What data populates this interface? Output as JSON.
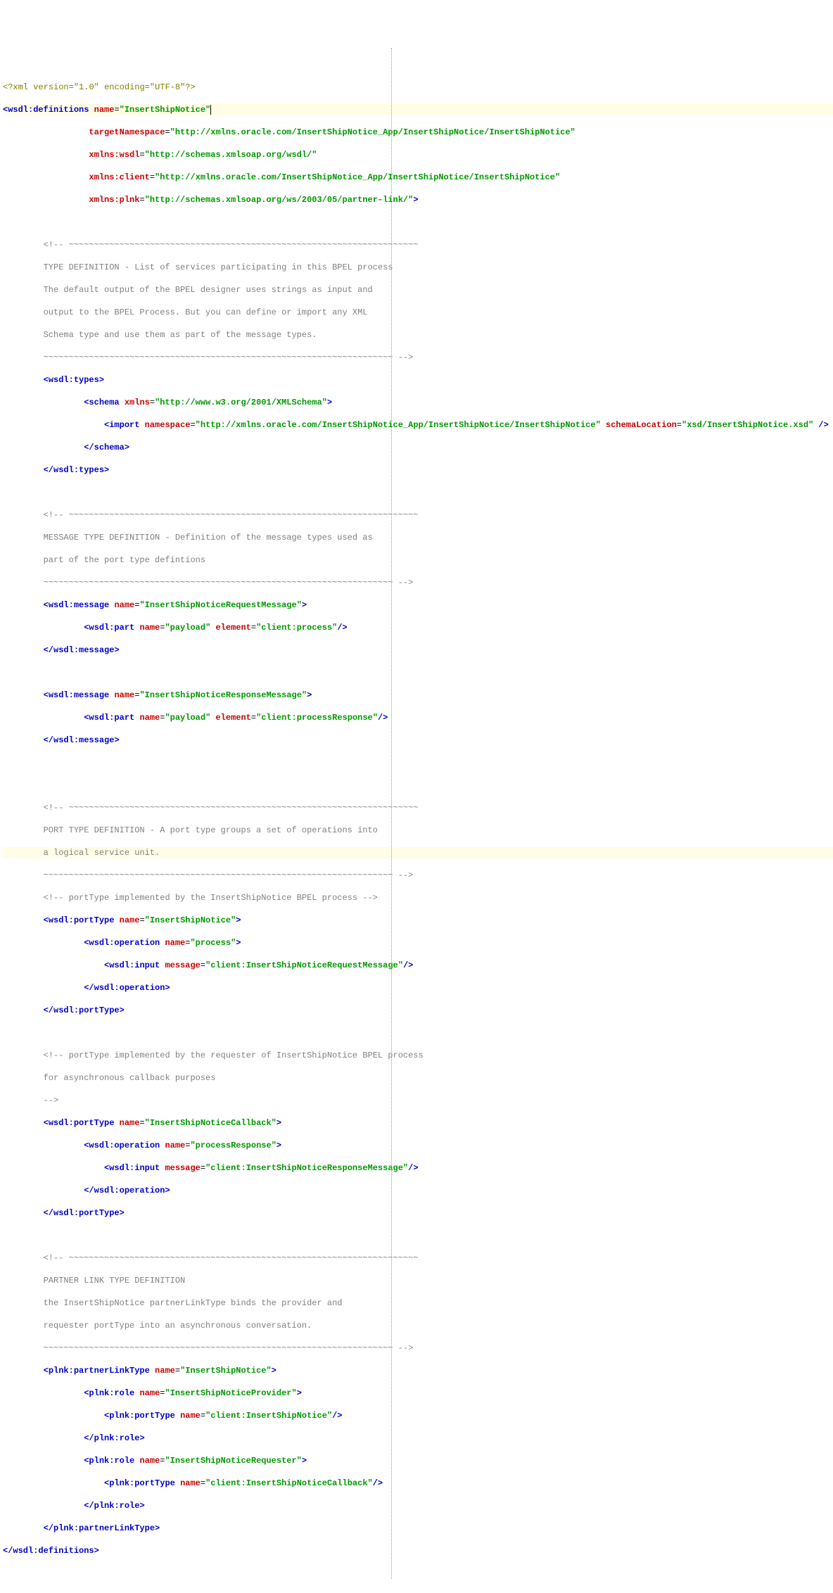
{
  "xmlDecl": {
    "p0": "<?",
    "p1": "xml ",
    "attrv": "version",
    "eq": "=",
    "v": "\"1.0\"",
    "sp": " ",
    "attre": "encoding",
    "ev": "\"UTF-8\"",
    "end": "?>"
  },
  "definitions": {
    "open": "<",
    "el": "wsdl:definitions",
    "sp": " ",
    "aName": "name",
    "eq": "=",
    "nameVal": "\"InsertShipNotice\"",
    "tns": {
      "attr": "targetNamespace",
      "eq": "=",
      "val": "\"http://xmlns.oracle.com/InsertShipNotice_App/InsertShipNotice/InsertShipNotice\""
    },
    "xmlnsWsdl": {
      "attr": "xmlns:wsdl",
      "eq": "=",
      "val": "\"http://schemas.xmlsoap.org/wsdl/\""
    },
    "xmlnsClient": {
      "attr": "xmlns:client",
      "eq": "=",
      "val": "\"http://xmlns.oracle.com/InsertShipNotice_App/InsertShipNotice/InsertShipNotice\""
    },
    "xmlnsPlnk": {
      "attr": "xmlns:plnk",
      "eq": "=",
      "val": "\"http://schemas.xmlsoap.org/ws/2003/05/partner-link/\"",
      "end": ">"
    },
    "close": "</",
    "closeEl": "wsdl:definitions",
    "closeGt": ">"
  },
  "comments": {
    "typeDefTop": "<!-- ~~~~~~~~~~~~~~~~~~~~~~~~~~~~~~~~~~~~~~~~~~~~~~~~~~~~~~~~~~~~~~~~~~~~~",
    "typeDef1": "TYPE DEFINITION - List of services participating in this BPEL process",
    "typeDef2": "The default output of the BPEL designer uses strings as input and",
    "typeDef3": "output to the BPEL Process. But you can define or import any XML",
    "typeDef4": "Schema type and use them as part of the message types.",
    "tilEnd": "~~~~~~~~~~~~~~~~~~~~~~~~~~~~~~~~~~~~~~~~~~~~~~~~~~~~~~~~~~~~~~~~~~~~~ -->",
    "msgTop": "<!-- ~~~~~~~~~~~~~~~~~~~~~~~~~~~~~~~~~~~~~~~~~~~~~~~~~~~~~~~~~~~~~~~~~~~~~",
    "msg1": "MESSAGE TYPE DEFINITION - Definition of the message types used as",
    "msg2": "part of the port type defintions",
    "portTop": "<!-- ~~~~~~~~~~~~~~~~~~~~~~~~~~~~~~~~~~~~~~~~~~~~~~~~~~~~~~~~~~~~~~~~~~~~~",
    "port1": "PORT TYPE DEFINITION - A port type groups a set of operations into",
    "port2": "a logical service unit.",
    "portImpl": "<!-- portType implemented by the InsertShipNotice BPEL process -->",
    "portReq1": "<!-- portType implemented by the requester of InsertShipNotice BPEL process",
    "portReq2": "for asynchronous callback purposes",
    "portReq3": "-->",
    "plnkTop": "<!-- ~~~~~~~~~~~~~~~~~~~~~~~~~~~~~~~~~~~~~~~~~~~~~~~~~~~~~~~~~~~~~~~~~~~~~",
    "plnk1": "PARTNER LINK TYPE DEFINITION",
    "plnk2": "the InsertShipNotice partnerLinkType binds the provider and",
    "plnk3": "requester portType into an asynchronous conversation."
  },
  "types": {
    "open": "<",
    "el": "wsdl:types",
    "gt": ">",
    "schemaOpen": "<",
    "schemaEl": "schema",
    "sp": " ",
    "attrXmlns": "xmlns",
    "eq": "=",
    "xmlnsVal": "\"http://www.w3.org/2001/XMLSchema\"",
    "gt2": ">",
    "importOpen": "<",
    "importEl": "import",
    "sp2": " ",
    "attrNs": "namespace",
    "nsVal": "\"http://xmlns.oracle.com/InsertShipNotice_App/InsertShipNotice/InsertShipNotice\"",
    "sp3": " ",
    "attrLoc": "schemaLocation",
    "locVal": "\"xsd/InsertShipNotice.xsd\"",
    "end": " />",
    "schemaClose": "</",
    "schemaCloseEl": "schema",
    "schemaCloseGt": ">",
    "close": "</",
    "closeEl": "wsdl:types",
    "closeGt": ">"
  },
  "msg1": {
    "open": "<",
    "el": "wsdl:message",
    "sp": " ",
    "aName": "name",
    "eq": "=",
    "nameVal": "\"InsertShipNoticeRequestMessage\"",
    "gt": ">",
    "partOpen": "<",
    "partEl": "wsdl:part",
    "sp2": " ",
    "aPartName": "name",
    "partNameVal": "\"payload\"",
    "sp3": " ",
    "aElem": "element",
    "elemVal": "\"client:process\"",
    "end": "/>",
    "close": "</",
    "closeEl": "wsdl:message",
    "closeGt": ">"
  },
  "msg2": {
    "open": "<",
    "el": "wsdl:message",
    "sp": " ",
    "aName": "name",
    "eq": "=",
    "nameVal": "\"InsertShipNoticeResponseMessage\"",
    "gt": ">",
    "partOpen": "<",
    "partEl": "wsdl:part",
    "sp2": " ",
    "aPartName": "name",
    "partNameVal": "\"payload\"",
    "sp3": " ",
    "aElem": "element",
    "elemVal": "\"client:processResponse\"",
    "end": "/>",
    "close": "</",
    "closeEl": "wsdl:message",
    "closeGt": ">"
  },
  "pt1": {
    "open": "<",
    "el": "wsdl:portType",
    "sp": " ",
    "aName": "name",
    "eq": "=",
    "nameVal": "\"InsertShipNotice\"",
    "gt": ">",
    "opOpen": "<",
    "opEl": "wsdl:operation",
    "sp2": " ",
    "aOpName": "name",
    "opNameVal": "\"process\"",
    "gt2": ">",
    "inOpen": "<",
    "inEl": "wsdl:input",
    "sp3": " ",
    "aMsg": "message",
    "msgVal": "\"client:InsertShipNoticeRequestMessage\"",
    "end": "/>",
    "opClose": "</",
    "opCloseEl": "wsdl:operation",
    "opCloseGt": ">",
    "close": "</",
    "closeEl": "wsdl:portType",
    "closeGt": ">"
  },
  "pt2": {
    "open": "<",
    "el": "wsdl:portType",
    "sp": " ",
    "aName": "name",
    "eq": "=",
    "nameVal": "\"InsertShipNoticeCallback\"",
    "gt": ">",
    "opOpen": "<",
    "opEl": "wsdl:operation",
    "sp2": " ",
    "aOpName": "name",
    "opNameVal": "\"processResponse\"",
    "gt2": ">",
    "inOpen": "<",
    "inEl": "wsdl:input",
    "sp3": " ",
    "aMsg": "message",
    "msgVal": "\"client:InsertShipNoticeResponseMessage\"",
    "end": "/>",
    "opClose": "</",
    "opCloseEl": "wsdl:operation",
    "opCloseGt": ">",
    "close": "</",
    "closeEl": "wsdl:portType",
    "closeGt": ">"
  },
  "plnk": {
    "open": "<",
    "el": "plnk:partnerLinkType",
    "sp": " ",
    "aName": "name",
    "eq": "=",
    "nameVal": "\"InsertShipNotice\"",
    "gt": ">",
    "r1open": "<",
    "r1el": "plnk:role",
    "sp2": " ",
    "aR1Name": "name",
    "r1NameVal": "\"InsertShipNoticeProvider\"",
    "gt2": ">",
    "p1open": "<",
    "p1el": "plnk:portType",
    "sp3": " ",
    "aP1Name": "name",
    "p1NameVal": "\"client:InsertShipNotice\"",
    "end1": "/>",
    "r1close": "</",
    "r1closeEl": "plnk:role",
    "r1closeGt": ">",
    "r2open": "<",
    "r2el": "plnk:role",
    "sp4": " ",
    "aR2Name": "name",
    "r2NameVal": "\"InsertShipNoticeRequester\"",
    "gt3": ">",
    "p2open": "<",
    "p2el": "plnk:portType",
    "sp5": " ",
    "aP2Name": "name",
    "p2NameVal": "\"client:InsertShipNoticeCallback\"",
    "end2": "/>",
    "r2close": "</",
    "r2closeEl": "plnk:role",
    "r2closeGt": ">",
    "close": "</",
    "closeEl": "plnk:partnerLinkType",
    "closeGt": ">"
  },
  "indent": {
    "i1": "    ",
    "i2": "        ",
    "i3": "            ",
    "i4": "                ",
    "i5": "                    "
  }
}
